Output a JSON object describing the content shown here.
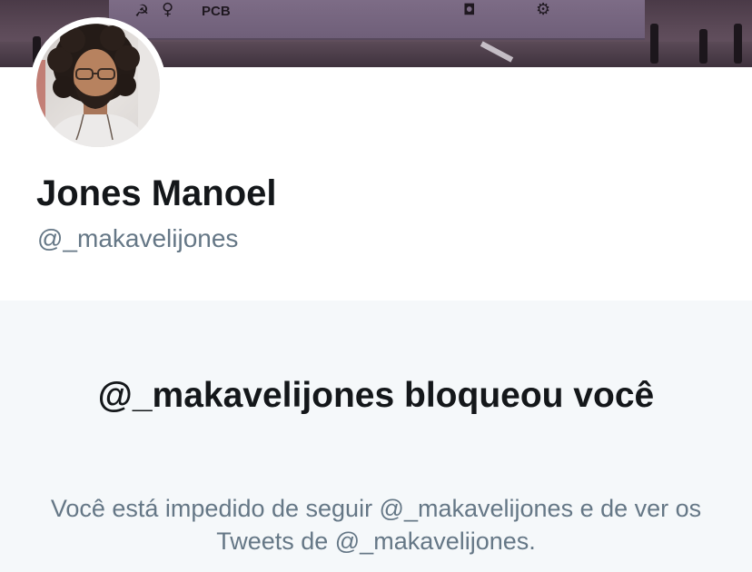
{
  "profile": {
    "name": "Jones Manoel",
    "handle": "@_makavelijones"
  },
  "banner": {
    "text": "PCB"
  },
  "blocked_notice": {
    "title": "@_makavelijones bloqueou você",
    "description": "Você está impedido de seguir @_makavelijones e de ver os Tweets de @_makavelijones."
  },
  "colors": {
    "name_text": "#14171a",
    "secondary_text": "#657786",
    "panel_background": "#f5f8fa",
    "page_background": "#ffffff"
  }
}
